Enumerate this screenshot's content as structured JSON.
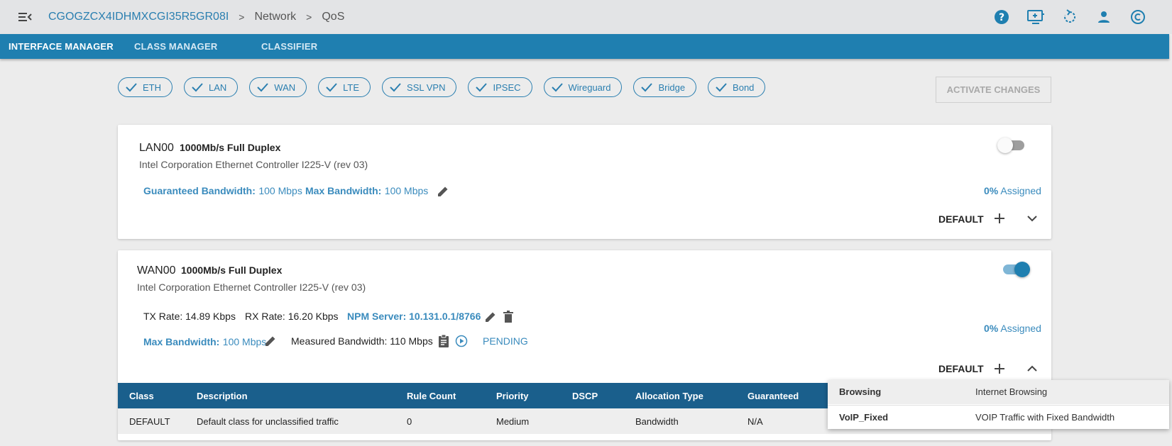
{
  "header": {
    "device_id": "CGOGZCX4IDHMXCGI35R5GR08I",
    "crumb_network": "Network",
    "crumb_qos": "QoS",
    "sep": ">"
  },
  "tabs": [
    {
      "label": "INTERFACE MANAGER",
      "active": true
    },
    {
      "label": "CLASS MANAGER",
      "active": false
    },
    {
      "label": "CLASSIFIER",
      "active": false
    }
  ],
  "filters": [
    "ETH",
    "LAN",
    "WAN",
    "LTE",
    "SSL VPN",
    "IPSEC",
    "Wireguard",
    "Bridge",
    "Bond"
  ],
  "activate_label": "ACTIVATE CHANGES",
  "lan": {
    "name": "LAN00",
    "speed": "1000Mb/s Full Duplex",
    "desc": "Intel Corporation Ethernet Controller I225-V (rev 03)",
    "guaranteed_label": "Guaranteed Bandwidth:",
    "guaranteed_value": "100 Mbps",
    "max_label": "Max Bandwidth:",
    "max_value": "100 Mbps",
    "assigned_pct": "0%",
    "assigned_text": "Assigned",
    "default_label": "DEFAULT",
    "enabled": false
  },
  "wan": {
    "name": "WAN00",
    "speed": "1000Mb/s Full Duplex",
    "desc": "Intel Corporation Ethernet Controller I225-V (rev 03)",
    "tx_rate": "TX Rate: 14.89 Kbps",
    "rx_rate": "RX Rate: 16.20 Kbps",
    "npm_server": "NPM Server: 10.131.0.1/8766",
    "max_label": "Max Bandwidth:",
    "max_value": "100 Mbps",
    "measured": "Measured Bandwidth: 110 Mbps",
    "status": "PENDING",
    "assigned_pct": "0%",
    "assigned_text": "Assigned",
    "default_label": "DEFAULT",
    "enabled": true
  },
  "table": {
    "headers": [
      "Class",
      "Description",
      "Rule Count",
      "Priority",
      "DSCP",
      "Allocation Type",
      "Guaranteed"
    ],
    "rows": [
      [
        "DEFAULT",
        "Default class for unclassified traffic",
        "0",
        "Medium",
        "",
        "Bandwidth",
        "N/A"
      ]
    ]
  },
  "popup": [
    {
      "name": "Browsing",
      "desc": "Internet Browsing"
    },
    {
      "name": "VoIP_Fixed",
      "desc": "VOIP Traffic with Fixed Bandwidth"
    }
  ],
  "colors": {
    "primary": "#1f7fb0",
    "table_header": "#1a5f8c",
    "accent_text": "#3a8bbd"
  }
}
